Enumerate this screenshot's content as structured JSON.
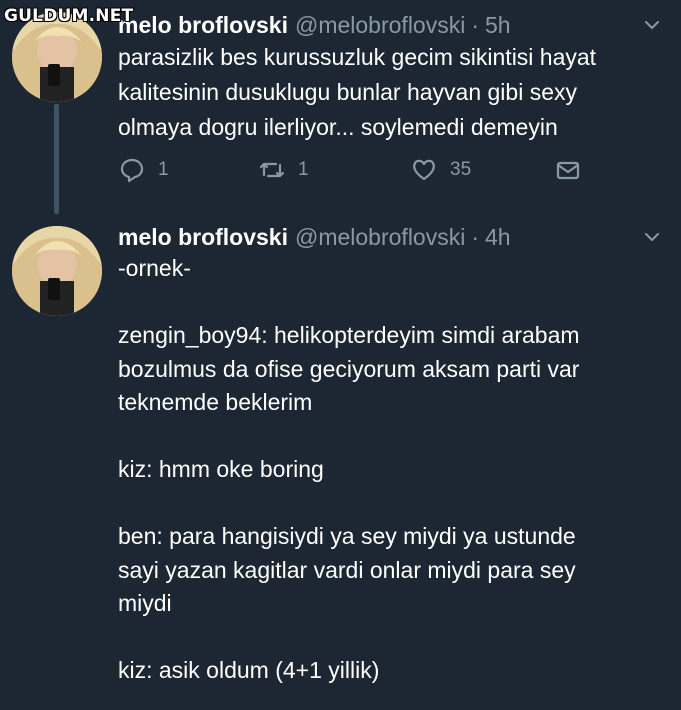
{
  "watermark": "GULDUM.NET",
  "tweets": [
    {
      "name": "melo broflovski",
      "handle": "@melobroflovski",
      "separator": "·",
      "time": "5h",
      "lines": [
        "parasizlik bes kurussuzluk gecim sikintisi hayat",
        "kalitesinin dusuklugu bunlar hayvan gibi sexy",
        "olmaya dogru ilerliyor... soylemedi demeyin"
      ],
      "reply_count": "1",
      "retweet_count": "1",
      "like_count": "35"
    },
    {
      "name": "melo broflovski",
      "handle": "@melobroflovski",
      "separator": "·",
      "time": "4h",
      "lines": [
        "-ornek-",
        "",
        "zengin_boy94: helikopterdeyim simdi arabam",
        "bozulmus da ofise geciyorum aksam parti var",
        "teknemde beklerim",
        "",
        "kiz: hmm oke boring",
        "",
        "ben: para hangisiydi ya sey miydi ya ustunde",
        "sayi yazan kagitlar vardi onlar miydi para sey",
        "miydi",
        "",
        "kiz: asik oldum (4+1 yillik)"
      ]
    }
  ],
  "icons": {
    "reply": "reply-icon",
    "retweet": "retweet-icon",
    "like": "heart-icon",
    "dm": "envelope-icon",
    "more": "chevron-down-icon"
  },
  "colors": {
    "background": "#1c2733",
    "secondary_text": "#8899a6",
    "thread_line": "#3d5466"
  }
}
